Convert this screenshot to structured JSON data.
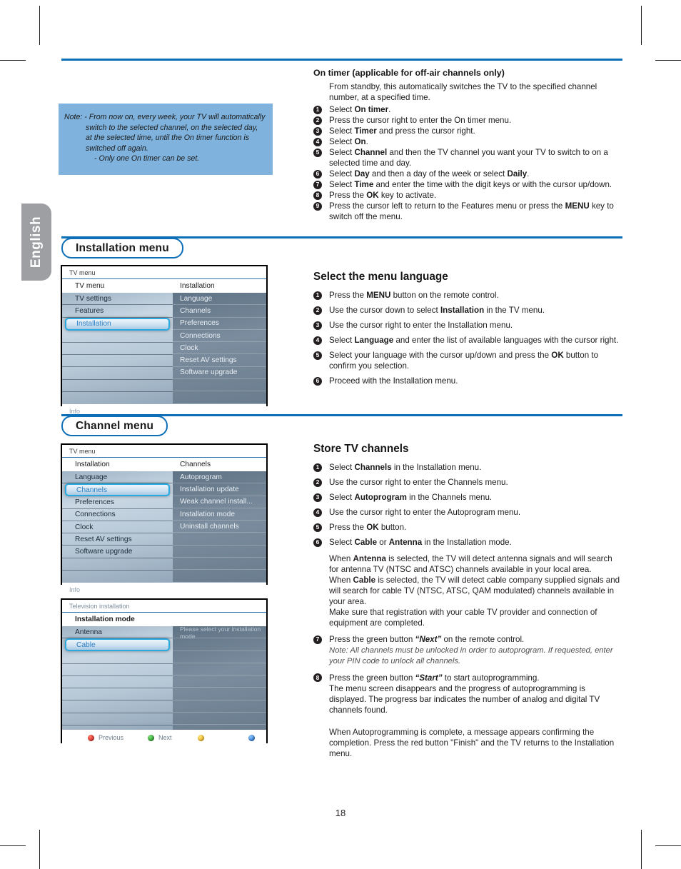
{
  "page": {
    "language_tab": "English",
    "page_number": "18",
    "accent_blue": "#0d6fb8",
    "note_box_bg": "#7fb2dc"
  },
  "note_box": {
    "label": "Note:",
    "line1": "- From now on, every week, your TV will automatically",
    "line2": "switch to the selected channel, on the selected day,",
    "line3": "at the selected time, until the On timer function is",
    "line4": "switched off again.",
    "line5": "- Only one On timer can be set."
  },
  "on_timer": {
    "heading": "On timer (applicable for off-air channels only)",
    "intro": "From standby, this automatically switches the TV to the specified channel number, at a specified time.",
    "steps": [
      "Select On timer.",
      "Press the cursor right to enter the On timer menu.",
      "Select Timer and press the cursor right.",
      "Select On.",
      "Select Channel and then the TV channel you want your TV to switch to on a selected time and day.",
      "Select Day and then a day of the week or select Daily.",
      "Select Time and enter the time with the digit keys or with the cursor up/down.",
      "Press the OK key to activate.",
      "Press the cursor left to return to the Features menu or press the MENU key to switch off the menu."
    ]
  },
  "installation_section": {
    "pill_label": "Installation menu",
    "osd": {
      "title": "TV menu",
      "sub_left": "TV menu",
      "sub_right": "Installation",
      "left_items": [
        "TV settings",
        "Features",
        "Installation"
      ],
      "left_selected": "Installation",
      "right_items": [
        "Language",
        "Channels",
        "Preferences",
        "Connections",
        "Clock",
        "Reset AV settings",
        "Software upgrade"
      ],
      "info_label": "Info"
    },
    "heading": "Select the menu language",
    "steps": [
      "Press the MENU button on the remote control.",
      "Use the cursor down to select Installation in the TV menu.",
      "Use the cursor right to enter the Installation menu.",
      "Select Language and enter the list of available languages with the cursor right.",
      "Select your language with the cursor up/down and press the OK button to confirm you selection.",
      "Proceed with the Installation menu."
    ]
  },
  "channel_section": {
    "pill_label": "Channel menu",
    "osd": {
      "title": "TV menu",
      "sub_left": "Installation",
      "sub_right": "Channels",
      "left_items": [
        "Language",
        "Channels",
        "Preferences",
        "Connections",
        "Clock",
        "Reset AV settings",
        "Software upgrade"
      ],
      "left_selected": "Channels",
      "right_items": [
        "Autoprogram",
        "Installation update",
        "Weak channel install...",
        "Installation mode",
        "Uninstall channels"
      ],
      "info_label": "Info"
    },
    "osd2": {
      "title": "Television installation",
      "sub_left": "Installation mode",
      "left_items": [
        "Antenna",
        "Cable"
      ],
      "left_selected": "Cable",
      "right_hint": "Please select your installation mode",
      "buttons": [
        {
          "color": "red",
          "label": "Previous"
        },
        {
          "color": "green",
          "label": "Next"
        },
        {
          "color": "yellow",
          "label": ""
        },
        {
          "color": "blue",
          "label": ""
        }
      ]
    },
    "heading": "Store TV channels",
    "steps": [
      "Select Channels in the Installation menu.",
      "Use the cursor right to enter the Channels menu.",
      "Select Autoprogram in the Channels menu.",
      "Use the cursor right to enter the Autoprogram menu.",
      "Press the OK button.",
      "Select Cable or Antenna in the Installation mode."
    ],
    "body_antenna": "When Antenna is selected, the TV will detect antenna signals and will search for antenna TV (NTSC and ATSC) channels available in your local area.",
    "body_cable": "When Cable is selected, the TV will detect cable company supplied signals and will search for cable TV (NTSC, ATSC, QAM modulated) channels available in your area.",
    "body_registration": "Make sure that registration with your cable TV provider and connection of equipment are completed.",
    "step7": "Press the green button “Next” on the remote control.",
    "step7_note": "Note: All channels must be unlocked in order to autoprogram. If requested, enter your PIN code to unlock all channels.",
    "step8": "Press the green button “Start” to start autoprogramming.",
    "step8_body": "The menu screen disappears and the progress of autoprogramming is displayed. The progress bar indicates the number of analog and digital TV channels found.",
    "closing": "When Autoprogramming is complete, a message appears confirming the completion. Press the red button \"Finish\" and the TV returns to the Installation menu."
  }
}
